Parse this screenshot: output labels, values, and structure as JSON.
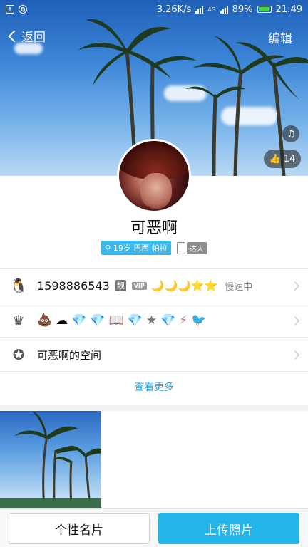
{
  "status_bar": {
    "speed": "3.26K/s",
    "network": "4G",
    "battery": "89%",
    "time": "21:49"
  },
  "nav": {
    "back_label": "返回",
    "edit_label": "编辑"
  },
  "cover": {
    "like_count": "14"
  },
  "profile": {
    "nickname": "可恶啊",
    "info_tag": "19岁 巴西 帕拉",
    "talent_tag": "达人"
  },
  "rows": {
    "qq_number": "1598886543",
    "liang_badge": "靓",
    "vip_badge": "VIP",
    "level_icons": "🌙🌙🌙⭐⭐",
    "speed_status": "慢速中",
    "space_label": "可恶啊的空间"
  },
  "more_label": "查看更多",
  "bottom": {
    "card_button": "个性名片",
    "upload_button": "上传照片"
  },
  "colors": {
    "accent": "#23b4ea",
    "link": "#2aa0d6"
  }
}
